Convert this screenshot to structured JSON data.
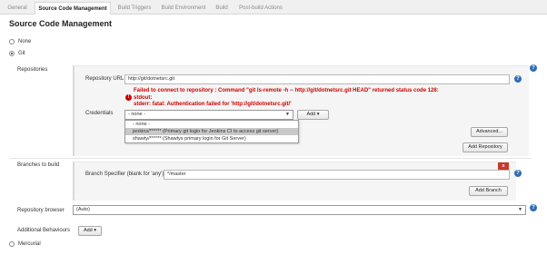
{
  "tabs": [
    {
      "label": "General"
    },
    {
      "label": "Source Code Management"
    },
    {
      "label": "Build Triggers"
    },
    {
      "label": "Build Environment"
    },
    {
      "label": "Build"
    },
    {
      "label": "Post-build Actions"
    }
  ],
  "section_title": "Source Code Management",
  "scm_options": {
    "none": "None",
    "git": "Git",
    "mercurial": "Mercurial"
  },
  "repositories": {
    "label": "Repositories",
    "url_label": "Repository URL",
    "url_value": "http://git/dotnetsrc.git",
    "errors": [
      "Failed to connect to repository : Command \"git ls-remote -h -- http://git/dotnetsrc.git HEAD\" returned status code 128:",
      "stdout:",
      "stderr: fatal: Authentication failed for 'http://git/dotnetsrc.git/'"
    ],
    "credentials_label": "Credentials",
    "credentials_selected": "- none -",
    "add_button": "Add",
    "credential_options": [
      "- none -",
      "jenkins/****** (Primary git login for Jenkins CI to access git server)",
      "shawty/****** (Shawtys primary login for Git Server)"
    ],
    "advanced_button": "Advanced...",
    "add_repository_button": "Add Repository"
  },
  "branches": {
    "label": "Branches to build",
    "specifier_label": "Branch Specifier (blank for 'any')",
    "specifier_value": "*/master",
    "delete_label": "x",
    "add_branch_button": "Add Branch"
  },
  "repository_browser": {
    "label": "Repository browser",
    "value": "(Auto)"
  },
  "additional_behaviours": {
    "label": "Additional Behaviours",
    "add_button": "Add"
  },
  "help_symbol": "?",
  "colors": {
    "error": "#cc0000",
    "help": "#2f6db5",
    "delete": "#c83a2a"
  }
}
